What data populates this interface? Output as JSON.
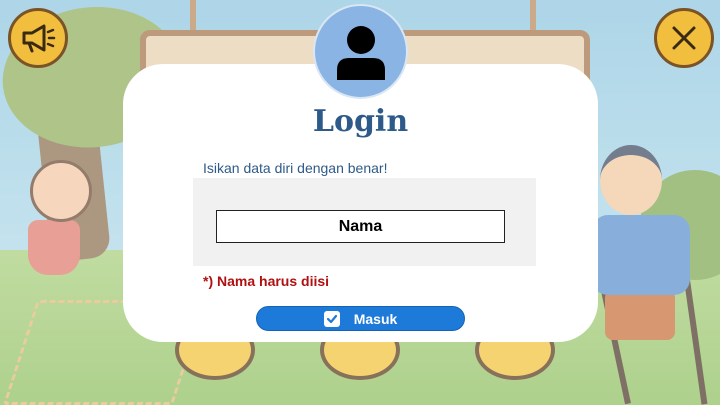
{
  "login": {
    "title": "Login",
    "instruction": "Isikan data diri dengan benar!",
    "name_field": {
      "value": "Nama",
      "placeholder": "Nama"
    },
    "error_text": "*) Nama harus diisi",
    "submit_label": "Masuk"
  },
  "icons": {
    "sound": "megaphone-icon",
    "close": "close-icon",
    "avatar": "user-icon",
    "submit": "checkbox-checked-icon"
  },
  "colors": {
    "title": "#2e5a8a",
    "error": "#b01010",
    "button": "#1e7ad8",
    "avatar_bg": "#8ab4e4",
    "corner_button": "#f2be3e"
  }
}
